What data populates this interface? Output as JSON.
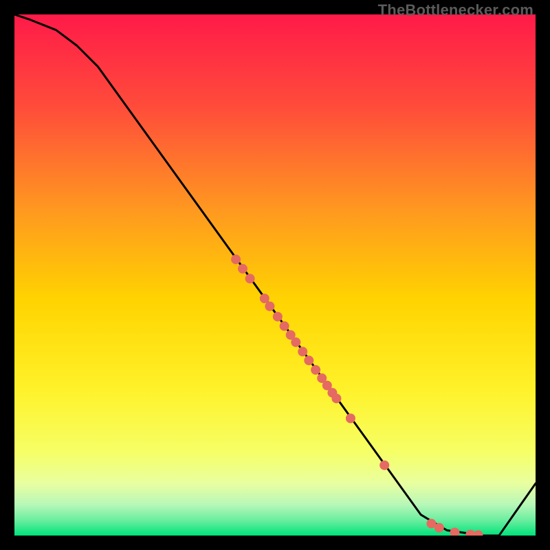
{
  "watermark": "TheBottlenecker.com",
  "colors": {
    "gradient_top": "#ff1a49",
    "gradient_mid_upper": "#ff7a2a",
    "gradient_mid": "#ffd400",
    "gradient_mid_lower": "#f6ff66",
    "gradient_band": "#d9ffc0",
    "gradient_bottom": "#00e37a",
    "curve": "#000000",
    "dots": "#e56a62",
    "frame": "#000000"
  },
  "chart_data": {
    "type": "line",
    "title": "",
    "xlabel": "",
    "ylabel": "",
    "xlim": [
      0,
      100
    ],
    "ylim": [
      0,
      100
    ],
    "series": [
      {
        "name": "bottleneck-curve",
        "x": [
          0,
          3,
          8,
          12,
          16,
          78,
          83,
          90,
          93,
          100
        ],
        "y": [
          100,
          99,
          97,
          94,
          90,
          4,
          1,
          0,
          0,
          10
        ]
      }
    ],
    "scatter": [
      {
        "name": "highlighted-points",
        "points": [
          {
            "x": 42.5,
            "y": 53.0
          },
          {
            "x": 43.8,
            "y": 51.2
          },
          {
            "x": 45.2,
            "y": 49.3
          },
          {
            "x": 48.0,
            "y": 45.5
          },
          {
            "x": 49.0,
            "y": 44.0
          },
          {
            "x": 50.5,
            "y": 42.0
          },
          {
            "x": 51.8,
            "y": 40.2
          },
          {
            "x": 53.0,
            "y": 38.5
          },
          {
            "x": 54.0,
            "y": 37.1
          },
          {
            "x": 55.3,
            "y": 35.3
          },
          {
            "x": 56.5,
            "y": 33.6
          },
          {
            "x": 57.8,
            "y": 31.8
          },
          {
            "x": 59.0,
            "y": 30.2
          },
          {
            "x": 60.0,
            "y": 28.8
          },
          {
            "x": 61.0,
            "y": 27.4
          },
          {
            "x": 61.8,
            "y": 26.3
          },
          {
            "x": 64.5,
            "y": 22.5
          },
          {
            "x": 71.0,
            "y": 13.5
          },
          {
            "x": 80.0,
            "y": 2.3
          },
          {
            "x": 81.5,
            "y": 1.5
          },
          {
            "x": 84.5,
            "y": 0.6
          },
          {
            "x": 87.5,
            "y": 0.2
          },
          {
            "x": 89.0,
            "y": 0.1
          }
        ]
      }
    ]
  }
}
